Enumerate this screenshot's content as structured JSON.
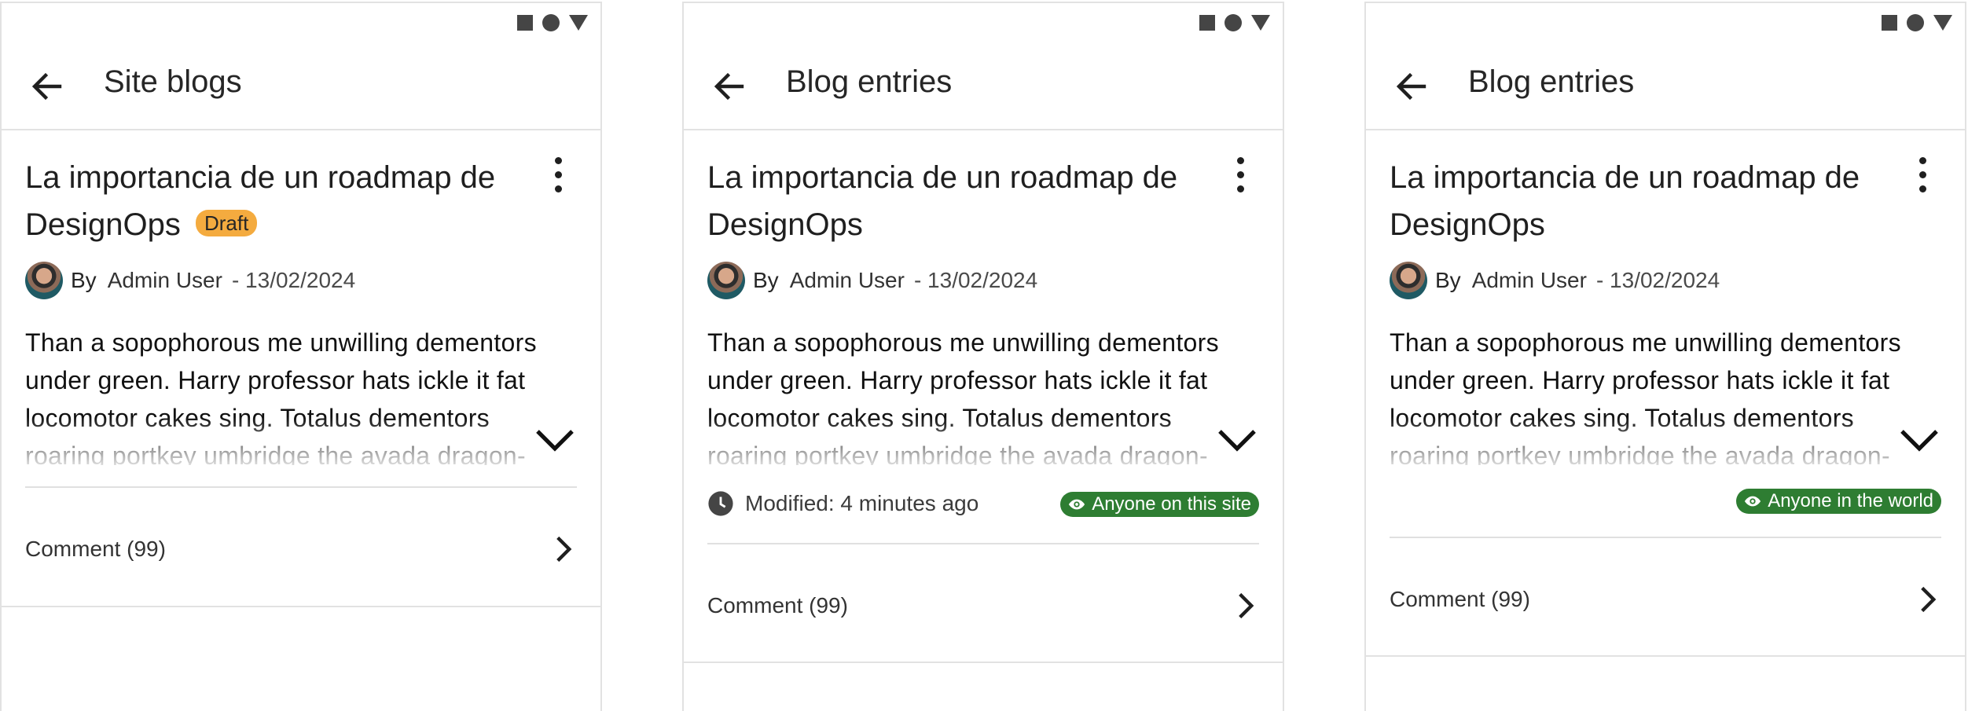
{
  "screens": [
    {
      "appbar": {
        "title": "Site blogs"
      },
      "post": {
        "title": "La importancia de un roadmap de DesignOps",
        "status_badge": "Draft",
        "by_label": "By",
        "author": "Admin User",
        "date": "- 13/02/2024",
        "excerpt": "Than a sopophorous me unwilling dementors under green. Harry professor hats ickle it fat locomotor cakes sing. Totalus dementors roaring portkey umbridge the avada dragon-",
        "comment_label": "Comment (99)"
      }
    },
    {
      "appbar": {
        "title": "Blog entries"
      },
      "post": {
        "title": "La importancia de un roadmap de DesignOps",
        "by_label": "By",
        "author": "Admin User",
        "date": "- 13/02/2024",
        "excerpt": "Than a sopophorous me unwilling dementors under green. Harry professor hats ickle it fat locomotor cakes sing. Totalus dementors roaring portkey umbridge the avada dragon-",
        "modified": "Modified: 4 minutes ago",
        "visibility": "Anyone on this site",
        "comment_label": "Comment (99)"
      }
    },
    {
      "appbar": {
        "title": "Blog entries"
      },
      "post": {
        "title": "La importancia de un roadmap de DesignOps",
        "by_label": "By",
        "author": "Admin User",
        "date": "- 13/02/2024",
        "excerpt": "Than a sopophorous me unwilling dementors under green. Harry professor hats ickle it fat locomotor cakes sing. Totalus dementors roaring portkey umbridge the avada dragon-",
        "visibility": "Anyone in the world",
        "comment_label": "Comment (99)"
      }
    }
  ],
  "status_bar_icons": [
    "square-icon",
    "circle-icon",
    "triangle-icon"
  ],
  "icons": {
    "back": "arrow-left-icon",
    "more": "more-vertical-icon",
    "expand": "chevron-down-icon",
    "comment": "chevron-right-icon",
    "modified": "clock-icon",
    "visibility": "eye-icon"
  },
  "colors": {
    "draft_badge": "#f4ab3f",
    "visibility_badge": "#2e7d32",
    "divider": "#e2e2e2",
    "status_icons": "#454545"
  }
}
